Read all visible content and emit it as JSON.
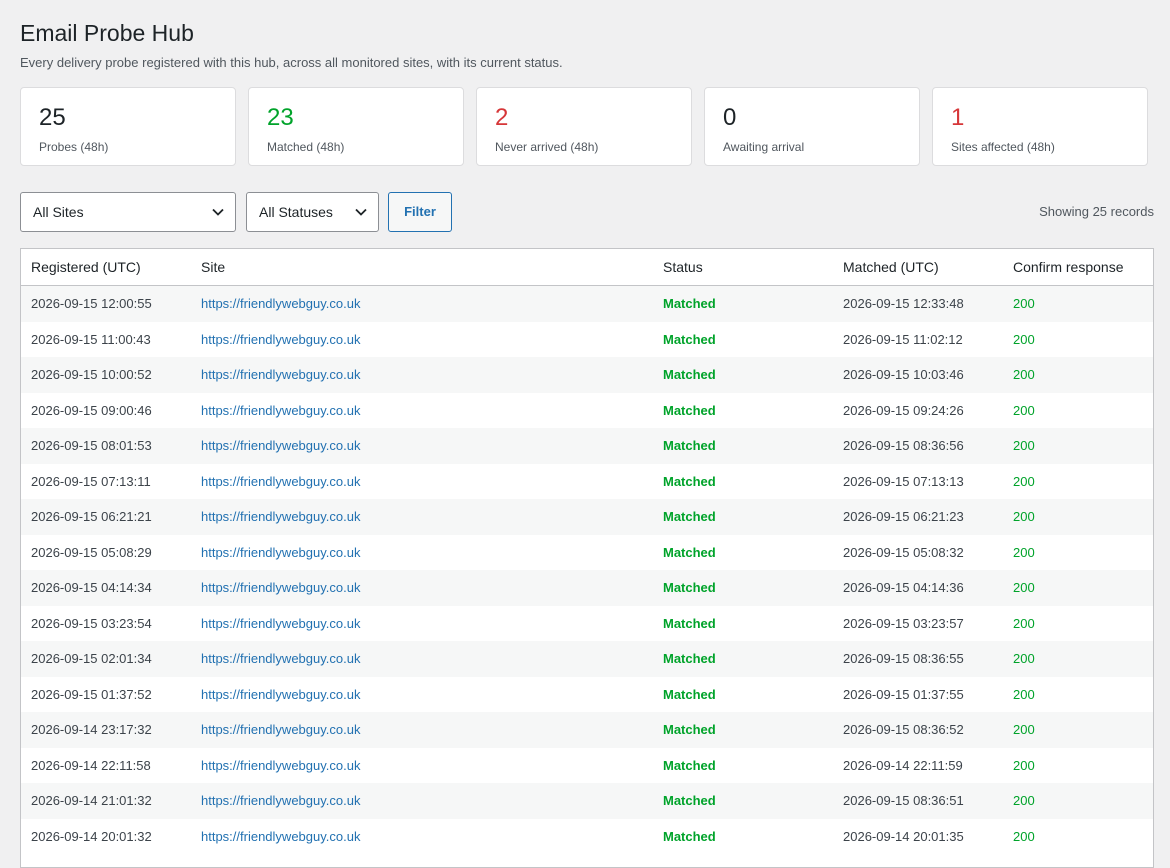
{
  "header": {
    "title": "Email Probe Hub",
    "subtitle": "Every delivery probe registered with this hub, across all monitored sites, with its current status."
  },
  "stats": [
    {
      "value": "25",
      "label": "Probes (48h)",
      "color": "#1d2327"
    },
    {
      "value": "23",
      "label": "Matched (48h)",
      "color": "#00a32a"
    },
    {
      "value": "2",
      "label": "Never arrived (48h)",
      "color": "#d63638"
    },
    {
      "value": "0",
      "label": "Awaiting arrival",
      "color": "#1d2327"
    },
    {
      "value": "1",
      "label": "Sites affected (48h)",
      "color": "#d63638"
    }
  ],
  "filters": {
    "site_select": "All Sites",
    "status_select": "All Statuses",
    "filter_button": "Filter",
    "records_text": "Showing 25 records"
  },
  "table": {
    "columns": [
      "Registered (UTC)",
      "Site",
      "Status",
      "Matched (UTC)",
      "Confirm response"
    ],
    "rows": [
      [
        "2026-09-15 12:00:55",
        "https://friendlywebguy.co.uk",
        "Matched",
        "2026-09-15 12:33:48",
        "200"
      ],
      [
        "2026-09-15 11:00:43",
        "https://friendlywebguy.co.uk",
        "Matched",
        "2026-09-15 11:02:12",
        "200"
      ],
      [
        "2026-09-15 10:00:52",
        "https://friendlywebguy.co.uk",
        "Matched",
        "2026-09-15 10:03:46",
        "200"
      ],
      [
        "2026-09-15 09:00:46",
        "https://friendlywebguy.co.uk",
        "Matched",
        "2026-09-15 09:24:26",
        "200"
      ],
      [
        "2026-09-15 08:01:53",
        "https://friendlywebguy.co.uk",
        "Matched",
        "2026-09-15 08:36:56",
        "200"
      ],
      [
        "2026-09-15 07:13:11",
        "https://friendlywebguy.co.uk",
        "Matched",
        "2026-09-15 07:13:13",
        "200"
      ],
      [
        "2026-09-15 06:21:21",
        "https://friendlywebguy.co.uk",
        "Matched",
        "2026-09-15 06:21:23",
        "200"
      ],
      [
        "2026-09-15 05:08:29",
        "https://friendlywebguy.co.uk",
        "Matched",
        "2026-09-15 05:08:32",
        "200"
      ],
      [
        "2026-09-15 04:14:34",
        "https://friendlywebguy.co.uk",
        "Matched",
        "2026-09-15 04:14:36",
        "200"
      ],
      [
        "2026-09-15 03:23:54",
        "https://friendlywebguy.co.uk",
        "Matched",
        "2026-09-15 03:23:57",
        "200"
      ],
      [
        "2026-09-15 02:01:34",
        "https://friendlywebguy.co.uk",
        "Matched",
        "2026-09-15 08:36:55",
        "200"
      ],
      [
        "2026-09-15 01:37:52",
        "https://friendlywebguy.co.uk",
        "Matched",
        "2026-09-15 01:37:55",
        "200"
      ],
      [
        "2026-09-14 23:17:32",
        "https://friendlywebguy.co.uk",
        "Matched",
        "2026-09-15 08:36:52",
        "200"
      ],
      [
        "2026-09-14 22:11:58",
        "https://friendlywebguy.co.uk",
        "Matched",
        "2026-09-14 22:11:59",
        "200"
      ],
      [
        "2026-09-14 21:01:32",
        "https://friendlywebguy.co.uk",
        "Matched",
        "2026-09-15 08:36:51",
        "200"
      ],
      [
        "2026-09-14 20:01:32",
        "https://friendlywebguy.co.uk",
        "Matched",
        "2026-09-14 20:01:35",
        "200"
      ]
    ]
  }
}
